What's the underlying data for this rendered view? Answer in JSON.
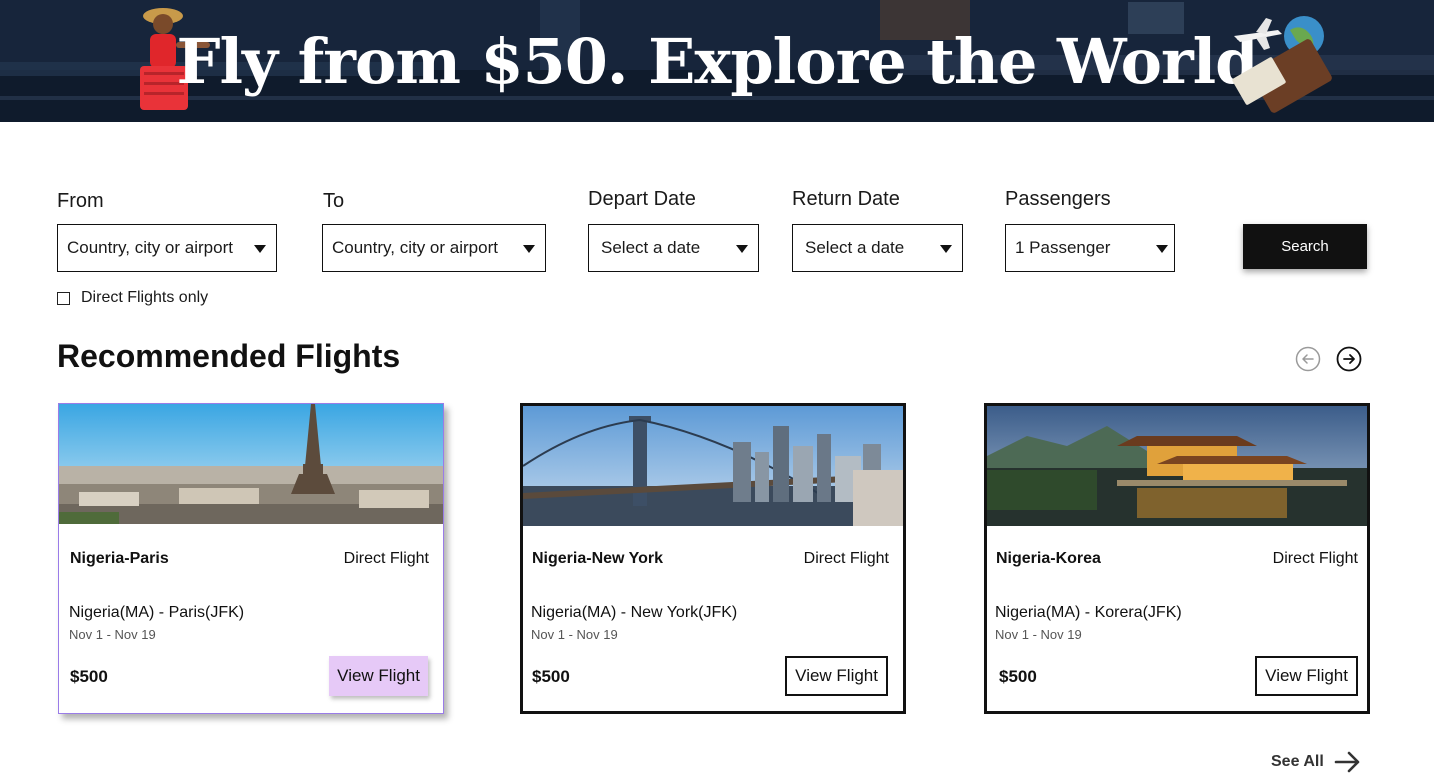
{
  "banner": {
    "title": "Fly from $50. Explore the World"
  },
  "search": {
    "from": {
      "label": "From",
      "value": "Country, city or airport"
    },
    "to": {
      "label": "To",
      "value": "Country, city or airport"
    },
    "depart": {
      "label": "Depart Date",
      "value": "Select a date"
    },
    "return": {
      "label": "Return Date",
      "value": "Select a date"
    },
    "passengers": {
      "label": "Passengers",
      "value": "1 Passenger"
    },
    "button_label": "Search",
    "direct_only_label": "Direct Flights only",
    "direct_only_checked": false
  },
  "recommended": {
    "title": "Recommended Flights",
    "see_all_label": "See All",
    "cards": [
      {
        "name": "Nigeria-Paris",
        "type": "Direct Flight",
        "route": "Nigeria(MA) - Paris(JFK)",
        "dates": "Nov 1 - Nov 19",
        "price": "$500",
        "button_label": "View Flight"
      },
      {
        "name": "Nigeria-New York",
        "type": "Direct Flight",
        "route": "Nigeria(MA) - New York(JFK)",
        "dates": "Nov 1 - Nov 19",
        "price": "$500",
        "button_label": "View Flight"
      },
      {
        "name": "Nigeria-Korea",
        "type": "Direct Flight",
        "route": "Nigeria(MA) - Korera(JFK)",
        "dates": "Nov 1 - Nov 19",
        "price": "$500",
        "button_label": "View Flight"
      }
    ]
  },
  "colors": {
    "banner_bg": "#16243a",
    "search_button": "#111111",
    "highlight_button": "#e6c9f7",
    "highlight_border": "#9a7ce8"
  },
  "icons": [
    "traveler-illustration",
    "plane-globe-icon",
    "arrow-left-circle-icon",
    "arrow-right-circle-icon",
    "arrow-right-icon",
    "caret-down-icon",
    "checkbox-icon"
  ]
}
